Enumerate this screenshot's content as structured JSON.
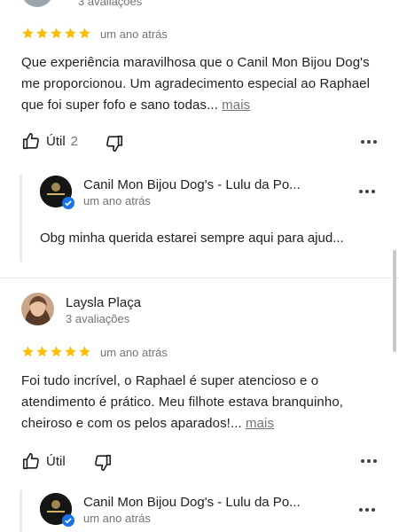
{
  "top_review": {
    "review_count": "3 avaliações",
    "time": "um ano atrás",
    "text": "Que experiência maravilhosa que o Canil Mon Bijou Dog's me proporcionou. Um agradecimento especial ao Raphael que foi super fofo e sano todas...",
    "more_label": "mais",
    "helpful_label": "Útil",
    "helpful_count": "2",
    "reply": {
      "owner_name": "Canil Mon Bijou Dog's - Lulu da Po...",
      "time": "um ano atrás",
      "text": "Obg minha querida estarei sempre aqui para ajud..."
    }
  },
  "second_review": {
    "user_name": "Laysla Plaça",
    "review_count": "3 avaliações",
    "time": "um ano atrás",
    "text": "Foi tudo incrível, o Raphael é super atencioso e o atendimento é prático. Meu filhote estava branquinho, cheiroso e com os pelos aparados!...",
    "more_label": "mais",
    "helpful_label": "Útil",
    "reply": {
      "owner_name": "Canil Mon Bijou Dog's - Lulu da Po...",
      "time": "um ano atrás"
    }
  },
  "rating_stars": 5,
  "colors": {
    "star": "#fbbc04",
    "verified": "#1a73e8",
    "muted": "#70757a"
  }
}
